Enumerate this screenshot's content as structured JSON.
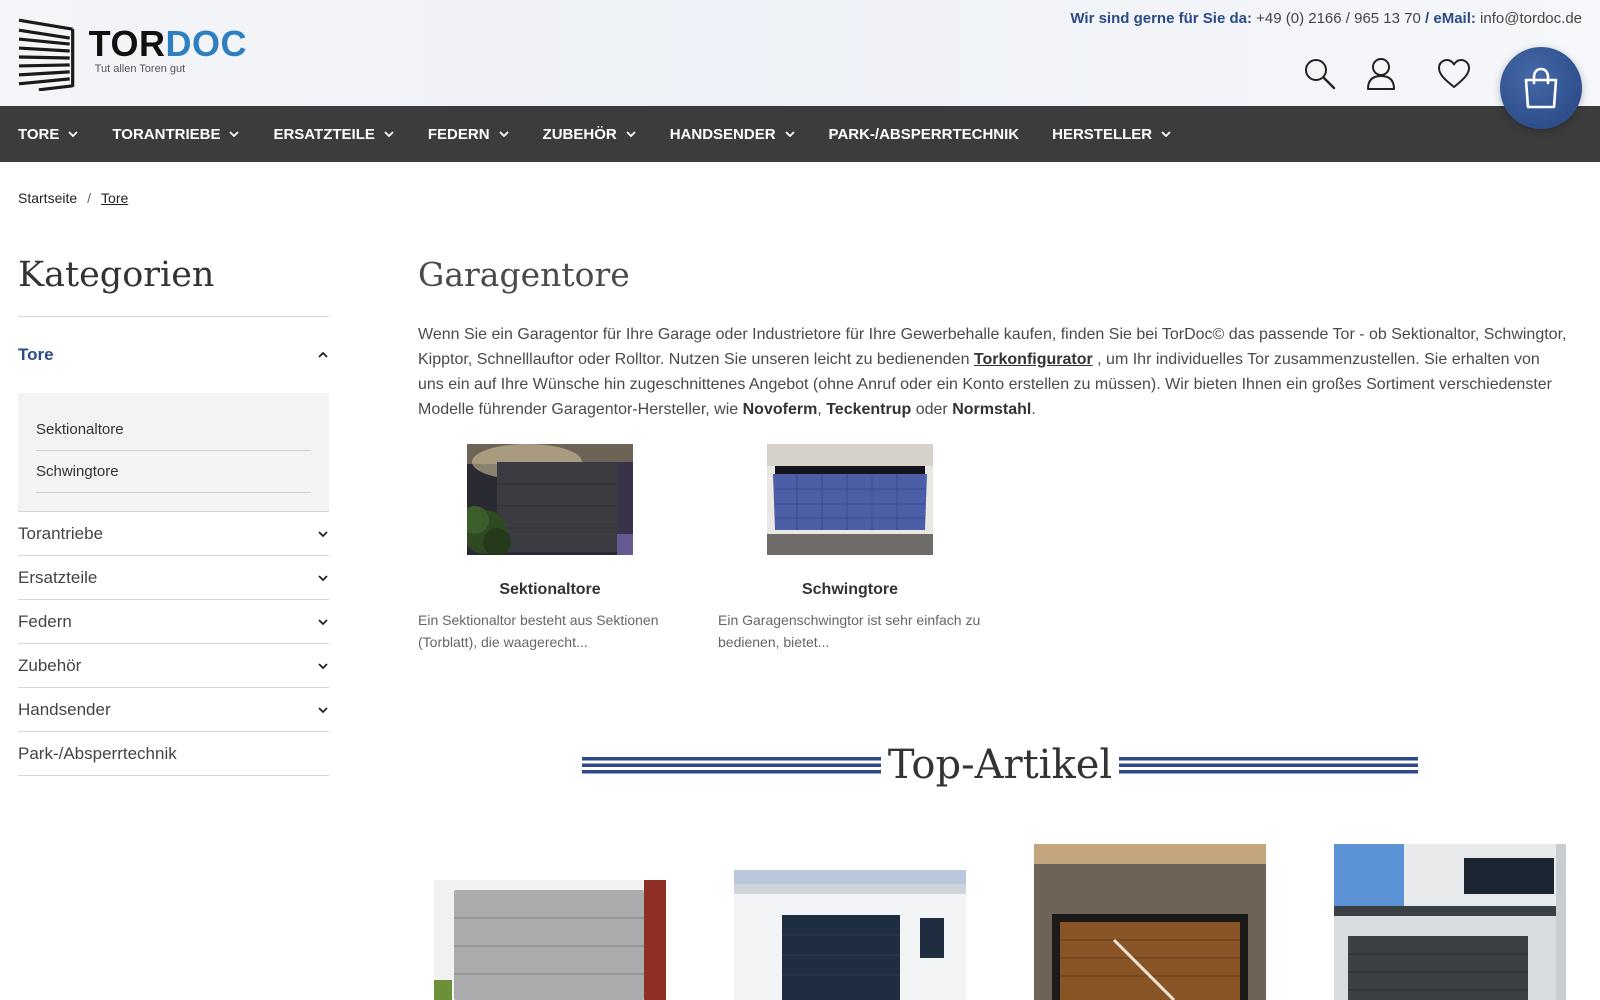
{
  "header": {
    "logo": {
      "brand_part1": "TOR",
      "brand_part2": "DOC",
      "tagline": "Tut allen Toren gut"
    },
    "contact": {
      "phone_label": "Wir sind gerne für Sie da:",
      "phone": "+49 (0) 2166 / 965 13 70",
      "email_label": "/ eMail:",
      "email": "info@tordoc.de"
    },
    "icons": [
      "search-icon",
      "user-icon",
      "heart-icon",
      "shopping-bag-icon"
    ]
  },
  "nav": {
    "items": [
      {
        "label": "TORE",
        "has_dropdown": true
      },
      {
        "label": "TORANTRIEBE",
        "has_dropdown": true
      },
      {
        "label": "ERSATZTEILE",
        "has_dropdown": true
      },
      {
        "label": "FEDERN",
        "has_dropdown": true
      },
      {
        "label": "ZUBEHÖR",
        "has_dropdown": true
      },
      {
        "label": "HANDSENDER",
        "has_dropdown": true
      },
      {
        "label": "PARK-/ABSPERRTECHNIK",
        "has_dropdown": false
      },
      {
        "label": "HERSTELLER",
        "has_dropdown": true
      }
    ]
  },
  "breadcrumb": {
    "home": "Startseite",
    "separator": "/",
    "current": "Tore"
  },
  "sidebar": {
    "title": "Kategorien",
    "active": {
      "label": "Tore",
      "children": [
        "Sektionaltore",
        "Schwingtore"
      ]
    },
    "items": [
      "Torantriebe",
      "Ersatzteile",
      "Federn",
      "Zubehör",
      "Handsender"
    ],
    "last_item": "Park-/Absperrtechnik"
  },
  "main": {
    "title": "Garagentore",
    "intro": {
      "part1": "Wenn Sie ein Garagentor für Ihre Garage oder Industrietore für Ihre Gewerbehalle kaufen, finden Sie bei TorDoc© das passende Tor - ob Sektionaltor, Schwingtor, Kipptor, Schnelllauftor oder Rolltor. Nutzen Sie unseren leicht zu bedienenden ",
      "link": "Torkonfigurator",
      "part2": " , um Ihr individuelles Tor zusammenzustellen. Sie erhalten von uns ein auf Ihre Wünsche hin zugeschnittenes Angebot (ohne Anruf oder ein Konto erstellen zu müssen). Wir bieten Ihnen ein großes Sortiment verschiedenster Modelle führender Garagentor-Hersteller, wie ",
      "brand1": "Novoferm",
      "comma": ",",
      "brand2": "Teckentrup",
      "or": " oder ",
      "brand3": "Normstahl",
      "period": "."
    },
    "categories": [
      {
        "name": "Sektionaltore",
        "desc": "Ein Sektionaltor besteht aus Sektionen (Torblatt), die waagerecht..."
      },
      {
        "name": "Schwingtore",
        "desc": "Ein Garagenschwingtor ist sehr einfach zu bedienen, bietet..."
      }
    ],
    "top_title": "Top-Artikel"
  },
  "colors": {
    "brand_blue": "#2b4a86",
    "nav_bg": "#3c3c3c",
    "logo_blue": "#2e7fbf"
  }
}
